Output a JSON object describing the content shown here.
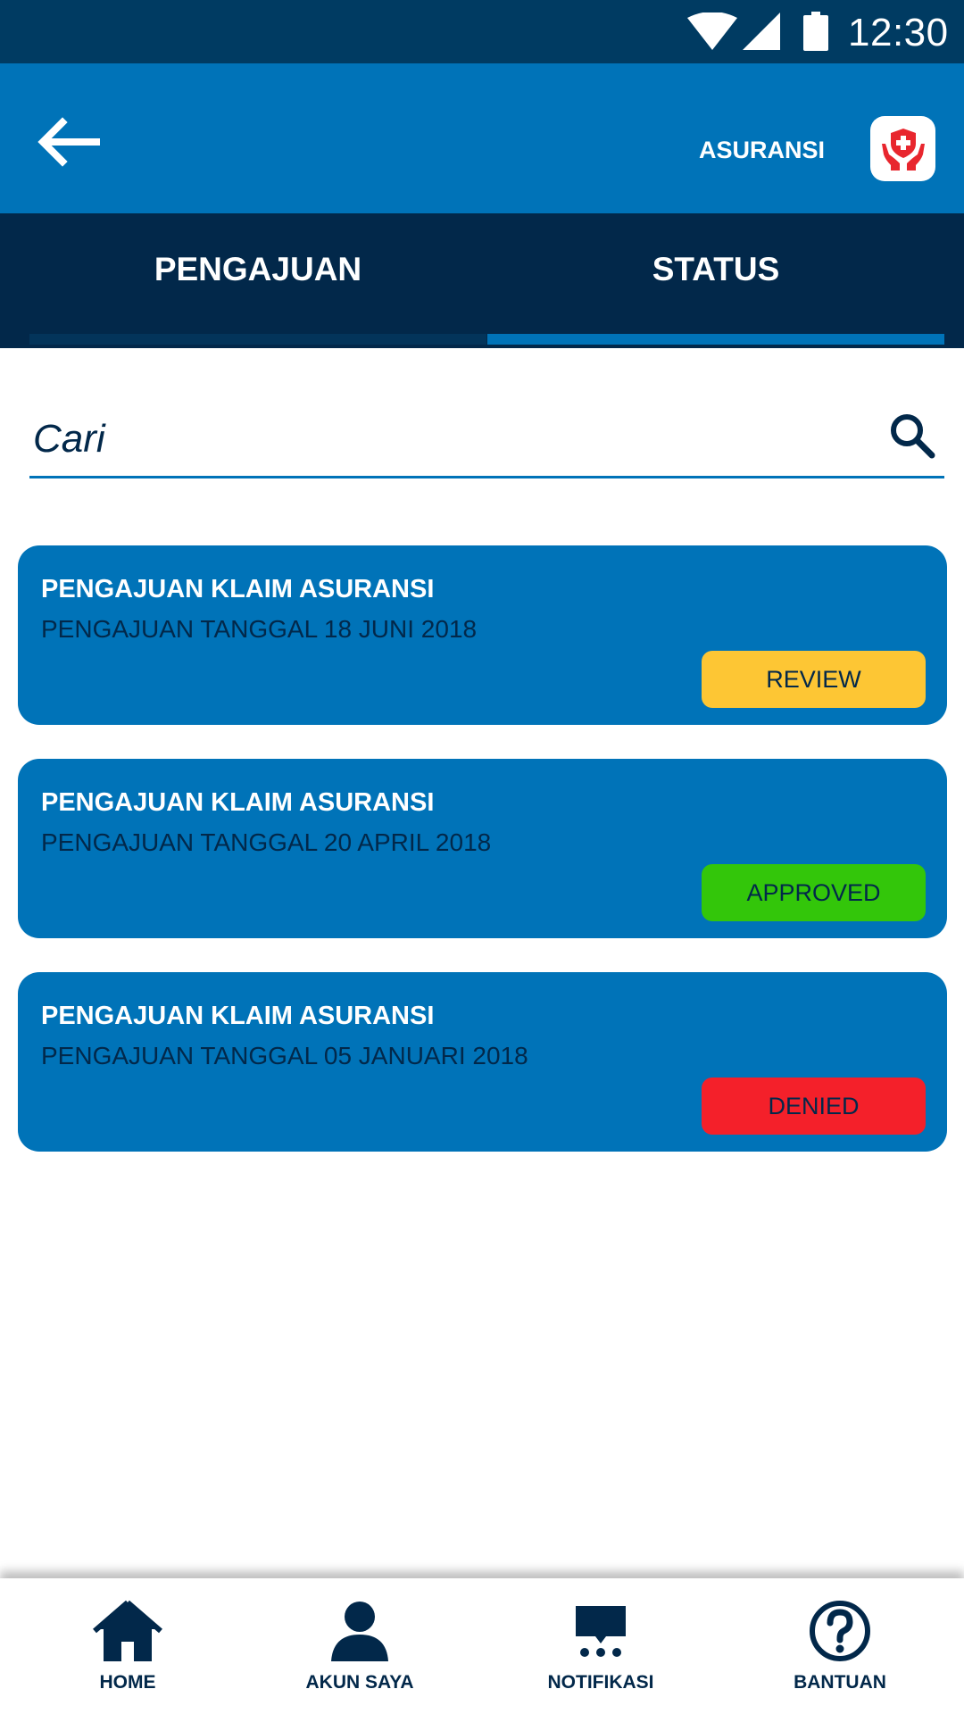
{
  "status_bar": {
    "time": "12:30",
    "icons": [
      "wifi-icon",
      "cell-signal-icon",
      "battery-icon"
    ]
  },
  "app_bar": {
    "title": "ASURANSI",
    "back_icon": "arrow-left-icon",
    "logo_icon": "insurance-hands-shield-icon"
  },
  "tabs": [
    {
      "label": "PENGAJUAN",
      "active": false
    },
    {
      "label": "STATUS",
      "active": true
    }
  ],
  "search": {
    "placeholder": "Cari",
    "value": "",
    "icon": "search-icon"
  },
  "claims": [
    {
      "title": "PENGAJUAN KLAIM ASURANSI",
      "date": "PENGAJUAN TANGGAL 18 JUNI 2018",
      "status": "REVIEW",
      "status_color": "#fdc634"
    },
    {
      "title": "PENGAJUAN KLAIM ASURANSI",
      "date": "PENGAJUAN TANGGAL 20 APRIL 2018",
      "status": "APPROVED",
      "status_color": "#33c60a"
    },
    {
      "title": "PENGAJUAN KLAIM ASURANSI",
      "date": "PENGAJUAN TANGGAL 05 JANUARI 2018",
      "status": "DENIED",
      "status_color": "#f4202a"
    }
  ],
  "bottom_nav": [
    {
      "label": "HOME",
      "icon": "home-icon"
    },
    {
      "label": "AKUN SAYA",
      "icon": "user-icon"
    },
    {
      "label": "NOTIFIKASI",
      "icon": "notification-icon"
    },
    {
      "label": "BANTUAN",
      "icon": "help-icon"
    }
  ],
  "colors": {
    "status_bar": "#003b62",
    "app_bar": "#0073b8",
    "tab_bar": "#02284a",
    "card": "#0073b8",
    "text_dark": "#02284a"
  }
}
